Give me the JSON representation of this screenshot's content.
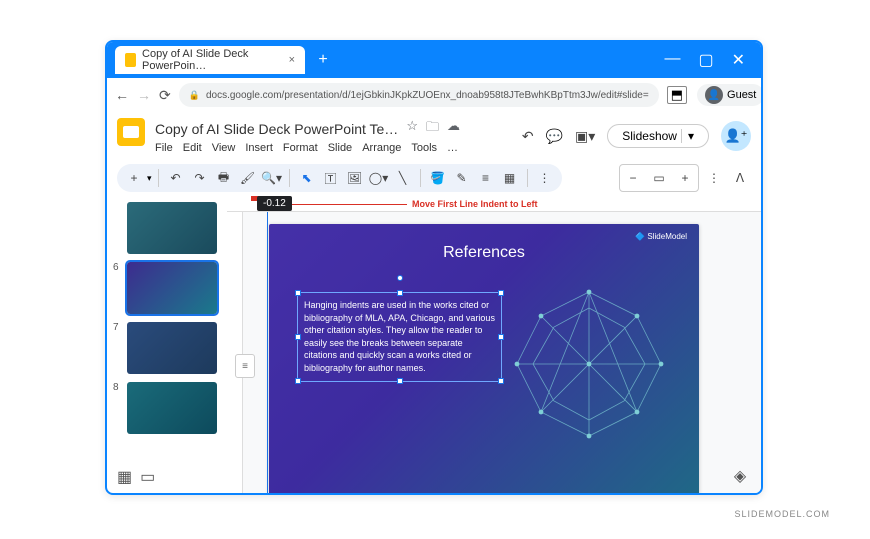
{
  "browser": {
    "tab_title": "Copy of AI Slide Deck PowerPoin…",
    "url": "docs.google.com/presentation/d/1ejGbkinJKpkZUOEnx_dnoab958t8JTeBwhKBpTtm3Jw/edit#slide=",
    "guest_label": "Guest"
  },
  "doc": {
    "title": "Copy of AI Slide Deck PowerPoint Te…",
    "menus": [
      "File",
      "Edit",
      "View",
      "Insert",
      "Format",
      "Slide",
      "Arrange",
      "Tools",
      "…"
    ],
    "slideshow": "Slideshow"
  },
  "toolbar": {
    "indent_value": "-0.12",
    "annotation": "Move First Line Indent to Left"
  },
  "thumbs": {
    "n6": "6",
    "n7": "7",
    "n8": "8"
  },
  "slide": {
    "title": "References",
    "logo": "🔷 SlideModel",
    "body": "Hanging indents are used in the works cited or bibliography of MLA, APA, Chicago, and various other citation styles. They allow the reader to easily see the breaks between separate citations and quickly scan a works cited or bibliography for author names.",
    "page": "6"
  },
  "watermark": "SLIDEMODEL.COM"
}
